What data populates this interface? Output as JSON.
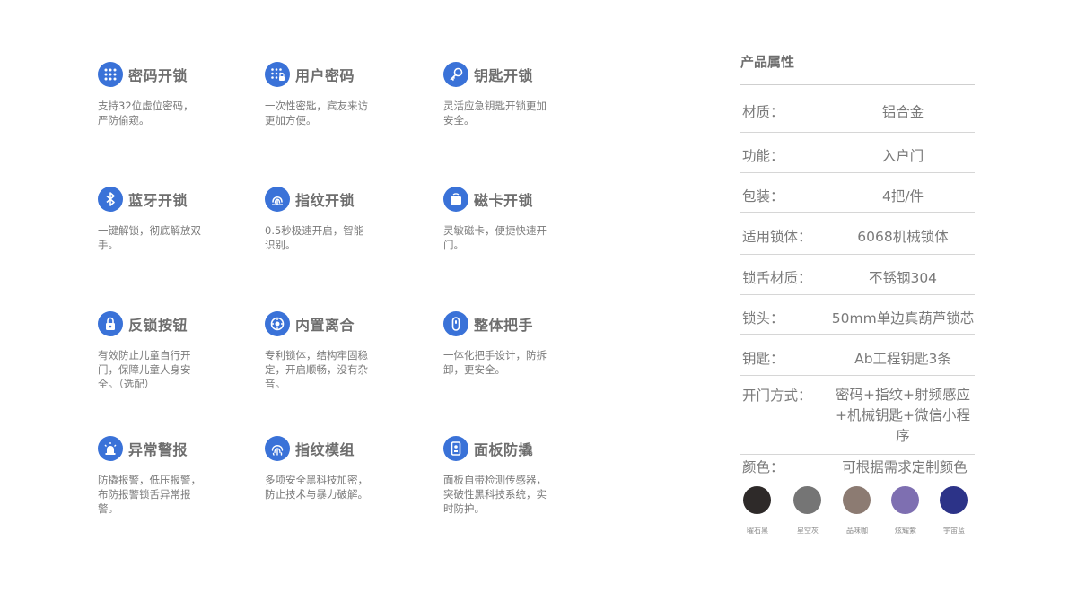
{
  "features": [
    {
      "title": "密码开锁",
      "desc": "支持32位虚位密码，严防偷窥。",
      "icon": "keypad-icon"
    },
    {
      "title": "用户密码",
      "desc": "一次性密匙，宾友来访更加方便。",
      "icon": "keypad-lock-icon"
    },
    {
      "title": "钥匙开锁",
      "desc": "灵活应急钥匙开锁更加安全。",
      "icon": "key-icon"
    },
    {
      "title": "蓝牙开锁",
      "desc": "一键解锁，彻底解放双手。",
      "icon": "bluetooth-icon"
    },
    {
      "title": "指纹开锁",
      "desc": "0.5秒极速开启，智能识别。",
      "icon": "fingerprint-icon"
    },
    {
      "title": "磁卡开锁",
      "desc": "灵敏磁卡，便捷快速开门。",
      "icon": "card-icon"
    },
    {
      "title": "反锁按钮",
      "desc": "有效防止儿童自行开门，保障儿童人身安全。（选配）",
      "icon": "padlock-icon"
    },
    {
      "title": "内置离合",
      "desc": "专利锁体，结构牢固稳定，开启顺畅，没有杂音。",
      "icon": "clutch-icon"
    },
    {
      "title": "整体把手",
      "desc": "一体化把手设计，防拆卸，更安全。",
      "icon": "handle-icon"
    },
    {
      "title": "异常警报",
      "desc": "防撬报警，低压报警，布防报警锁舌异常报警。",
      "icon": "alarm-icon"
    },
    {
      "title": "指纹模组",
      "desc": "多项安全黑科技加密，防止技术与暴力破解。",
      "icon": "fingerprint-module-icon"
    },
    {
      "title": "面板防撬",
      "desc": "面板自带检测传感器，突破性黑科技系统，实时防护。",
      "icon": "panel-icon"
    }
  ],
  "properties": {
    "title": "产品属性",
    "rows": [
      {
        "label": "材质：",
        "value": "铝合金"
      },
      {
        "label": "功能：",
        "value": "入户门"
      },
      {
        "label": "包装：",
        "value": "4把/件"
      },
      {
        "label": "适用锁体：",
        "value": "6068机械锁体"
      },
      {
        "label": "锁舌材质：",
        "value": "不锈钢304"
      },
      {
        "label": "锁头：",
        "value": "50mm单边真葫芦锁芯"
      },
      {
        "label": "钥匙：",
        "value": "Ab工程钥匙3条"
      },
      {
        "label": "开门方式：",
        "value": "密码+指纹+射频感应+机械钥匙+微信小程序"
      }
    ],
    "color_label": "颜色：",
    "color_note": "可根据需求定制颜色",
    "colors": [
      {
        "name": "曜石黑",
        "hex": "#2e2a29"
      },
      {
        "name": "星空灰",
        "hex": "#757575"
      },
      {
        "name": "品味咖",
        "hex": "#8c7b72"
      },
      {
        "name": "炫耀紫",
        "hex": "#7e6fb1"
      },
      {
        "name": "宇宙蓝",
        "hex": "#2c3388"
      }
    ]
  }
}
